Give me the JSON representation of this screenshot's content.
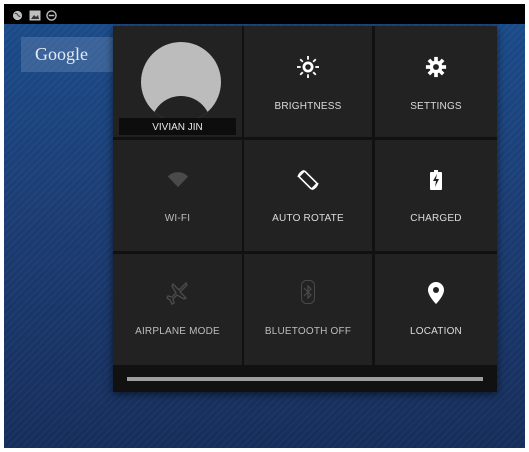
{
  "status_bar": {
    "icons": [
      "globe-icon",
      "image-icon",
      "do-not-disturb-icon"
    ]
  },
  "home": {
    "search_label": "Google"
  },
  "quick_settings": {
    "user": {
      "name": "VIVIAN JIN"
    },
    "tiles": [
      {
        "id": "brightness",
        "label": "BRIGHTNESS",
        "icon": "brightness-icon",
        "state": "on"
      },
      {
        "id": "settings",
        "label": "SETTINGS",
        "icon": "gear-icon",
        "state": "on"
      },
      {
        "id": "wifi",
        "label": "WI-FI",
        "icon": "wifi-icon",
        "state": "off"
      },
      {
        "id": "auto-rotate",
        "label": "AUTO ROTATE",
        "icon": "rotate-icon",
        "state": "on"
      },
      {
        "id": "battery",
        "label": "CHARGED",
        "icon": "battery-charging-icon",
        "state": "on"
      },
      {
        "id": "airplane",
        "label": "AIRPLANE MODE",
        "icon": "airplane-icon",
        "state": "off"
      },
      {
        "id": "bluetooth",
        "label": "BLUETOOTH OFF",
        "icon": "bluetooth-icon",
        "state": "off"
      },
      {
        "id": "location",
        "label": "LOCATION",
        "icon": "location-pin-icon",
        "state": "on"
      }
    ],
    "drag_handle_fill": 1.0
  },
  "colors": {
    "panel_bg": "#111111",
    "tile_bg": "#222222",
    "label_text": "#dcdcdc",
    "icon_off": "#4a4a4a",
    "wallpaper": "#1d3f77"
  }
}
